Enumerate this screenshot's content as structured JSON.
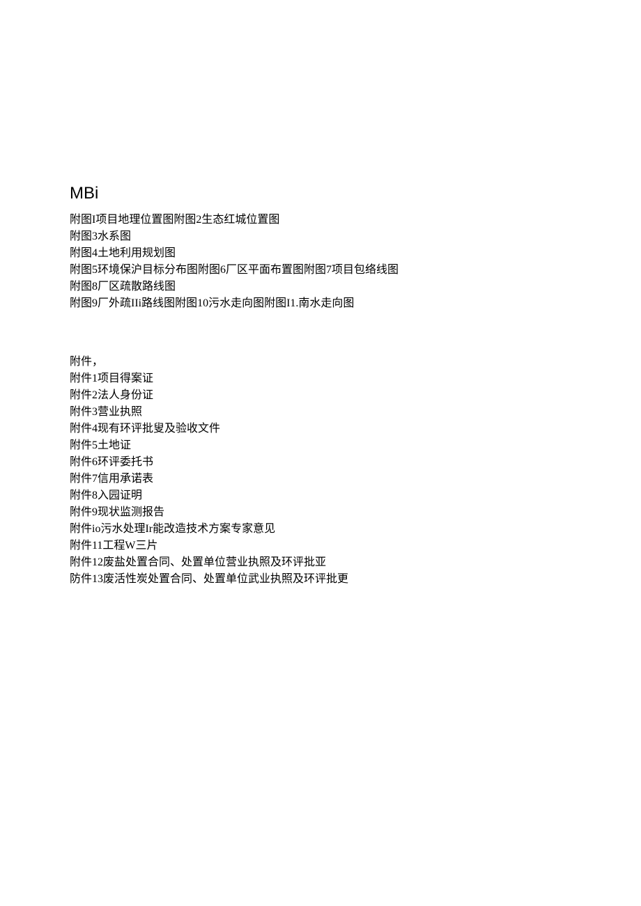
{
  "heading": "MBi",
  "figures": [
    "附图I项目地理位置图附图2生态红城位置图",
    "附图3水系图",
    "附图4土地利用规划图",
    "附图5环境保沪目标分布图附图6厂区平面布置图附图7项目包络线图",
    "附图8厂区疏散路线图",
    "附图9厂外疏IIi路线图附图10污水走向图附图I1.南水走向图"
  ],
  "attachments_header": "附件，",
  "attachments": [
    "附件1项目得案证",
    "附件2法人身份证",
    "附件3营业执照",
    "附件4现有环评批叟及验收文件",
    "附件5土地证",
    "附件6环评委托书",
    "附件7信用承诺表",
    "附件8入园证明",
    "附件9现状监测报告",
    "附件io污水处理Ir能改造技术方案专家意见",
    "附件11工程W三片",
    "附件12废盐处置合同、处置单位营业执照及环评批亚",
    "防件13废活性炭处置合同、处置单位武业执照及环评批更"
  ]
}
